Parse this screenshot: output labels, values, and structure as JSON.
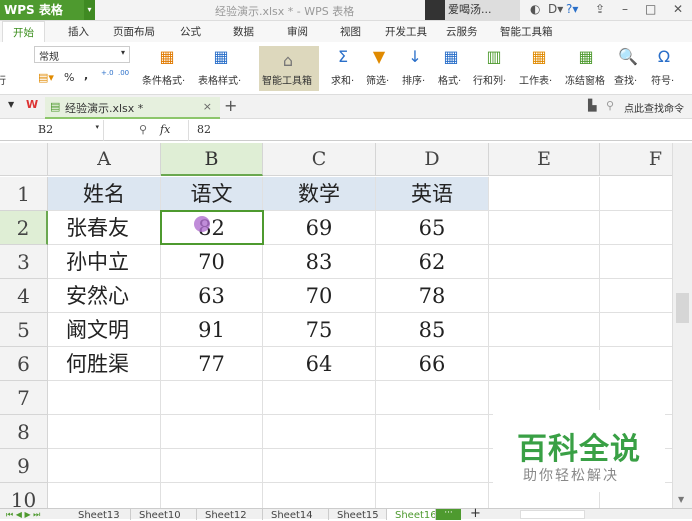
{
  "titlebar": {
    "app_button": "WPS 表格",
    "title": "经验演示.xlsx * - WPS 表格",
    "user": "爱喝汤..."
  },
  "menu": [
    "开始",
    "插入",
    "页面布局",
    "公式",
    "数据",
    "审阅",
    "视图",
    "开发工具",
    "云服务",
    "智能工具箱"
  ],
  "ribbon": {
    "wrap": "换行",
    "number_format": "常规",
    "percent": "%",
    "comma": ",",
    "cond_format": "条件格式·",
    "table_style": "表格样式·",
    "smart_toolbox": "智能工具箱",
    "sum": "求和·",
    "filter": "筛选·",
    "sort": "排序·",
    "format": "格式·",
    "rowcol": "行和列·",
    "worksheet": "工作表·",
    "freeze": "冻结窗格",
    "find": "查找·",
    "symbol": "符号·"
  },
  "doctab": {
    "name": "经验演示.xlsx *",
    "search": "点此查找命令"
  },
  "formula": {
    "cell_ref": "B2",
    "fx": "fx",
    "value": "82"
  },
  "columns": [
    "A",
    "B",
    "C",
    "D",
    "E",
    "F"
  ],
  "rows": [
    "1",
    "2",
    "3",
    "4",
    "5",
    "6",
    "7",
    "8",
    "9",
    "10"
  ],
  "table": {
    "headers": [
      "姓名",
      "语文",
      "数学",
      "英语"
    ],
    "data": [
      [
        "张春友",
        "82",
        "69",
        "65"
      ],
      [
        "孙中立",
        "70",
        "83",
        "62"
      ],
      [
        "安然心",
        "63",
        "70",
        "78"
      ],
      [
        "阚文明",
        "91",
        "75",
        "85"
      ],
      [
        "何胜渠",
        "77",
        "64",
        "66"
      ]
    ]
  },
  "sheets": [
    "Sheet13",
    "Sheet10",
    "Sheet12",
    "Sheet14",
    "Sheet15",
    "Sheet16"
  ],
  "active_sheet": "Sheet16",
  "watermark": {
    "line1": "百科全说",
    "line2": "助你轻松解决"
  }
}
